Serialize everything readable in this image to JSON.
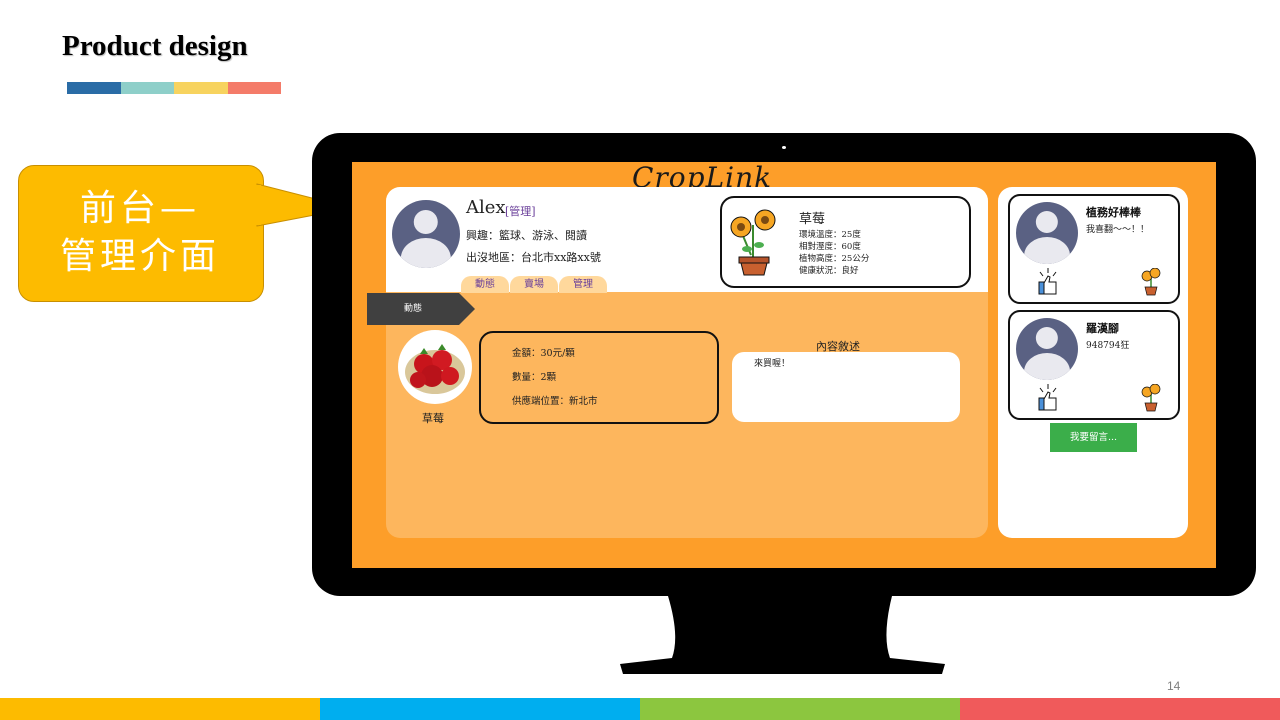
{
  "slide": {
    "title": "Product design",
    "page_number": "14",
    "title_bar_colors": [
      "#2a6ca6",
      "#8ecfc9",
      "#f7d35f",
      "#f47b69"
    ],
    "bottom_bar_colors": [
      "#fdbb00",
      "#00aeef",
      "#8cc63f",
      "#f05a5b"
    ]
  },
  "callout": {
    "line1": "前台—",
    "line2": "管理介面",
    "color": "#fdbb00"
  },
  "app": {
    "title": "CropLink",
    "screen_color": "#fd9e29",
    "profile": {
      "name": "Alex",
      "role_tag": "[管理]",
      "hobbies": "興趣：籃球、游泳、閱讀",
      "location": "出沒地區：台北市xx路xx號"
    },
    "tabs": [
      "動態",
      "賣場",
      "管理"
    ],
    "crop_card": {
      "name": "草莓",
      "stats": [
        "環境溫度：25度",
        "相對溼度：60度",
        "植物高度：25公分",
        "健康狀況：良好"
      ]
    },
    "feed": {
      "label": "動態",
      "product_name": "草莓",
      "price": "金額：30元/顆",
      "quantity": "數量：2顆",
      "supply_location": "供應端位置：新北市",
      "description_title": "內容敘述",
      "description_text": "來買喔！"
    },
    "comments": [
      {
        "name": "植務好棒棒",
        "text": "我喜翻～～！！"
      },
      {
        "name": "羅漢腳",
        "text": "948794狂"
      }
    ],
    "leave_message_button": "我要留言..."
  }
}
